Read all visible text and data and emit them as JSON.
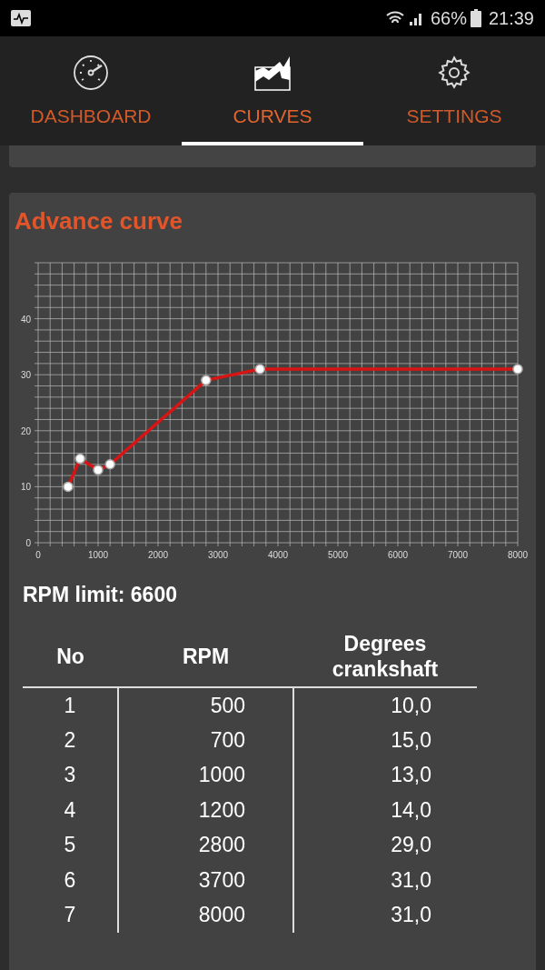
{
  "status_bar": {
    "battery": "66%",
    "time": "21:39"
  },
  "tabs": [
    {
      "label": "DASHBOARD",
      "selected": false
    },
    {
      "label": "CURVES",
      "selected": true
    },
    {
      "label": "SETTINGS",
      "selected": false
    }
  ],
  "card": {
    "title": "Advance curve",
    "chart_data": {
      "type": "line",
      "xlim": [
        0,
        8000
      ],
      "ylim": [
        0,
        50
      ],
      "xticks": [
        0,
        1000,
        2000,
        3000,
        4000,
        5000,
        6000,
        7000,
        8000
      ],
      "yticks": [
        0,
        10,
        20,
        30,
        40
      ],
      "grid": true,
      "x": [
        500,
        700,
        1000,
        1200,
        2800,
        3700,
        8000
      ],
      "series": [
        {
          "color": "#d81515",
          "marker": true,
          "values": [
            10,
            15,
            13,
            14,
            29,
            31,
            31
          ]
        }
      ]
    },
    "rpm_limit": "RPM limit: 6600",
    "table": {
      "columns": [
        "No",
        "RPM",
        "Degrees crankshaft"
      ],
      "rows": [
        [
          "1",
          "500",
          "10,0"
        ],
        [
          "2",
          "700",
          "15,0"
        ],
        [
          "3",
          "1000",
          "13,0"
        ],
        [
          "4",
          "1200",
          "14,0"
        ],
        [
          "5",
          "2800",
          "29,0"
        ],
        [
          "6",
          "3700",
          "31,0"
        ],
        [
          "7",
          "8000",
          "31,0"
        ]
      ]
    }
  }
}
